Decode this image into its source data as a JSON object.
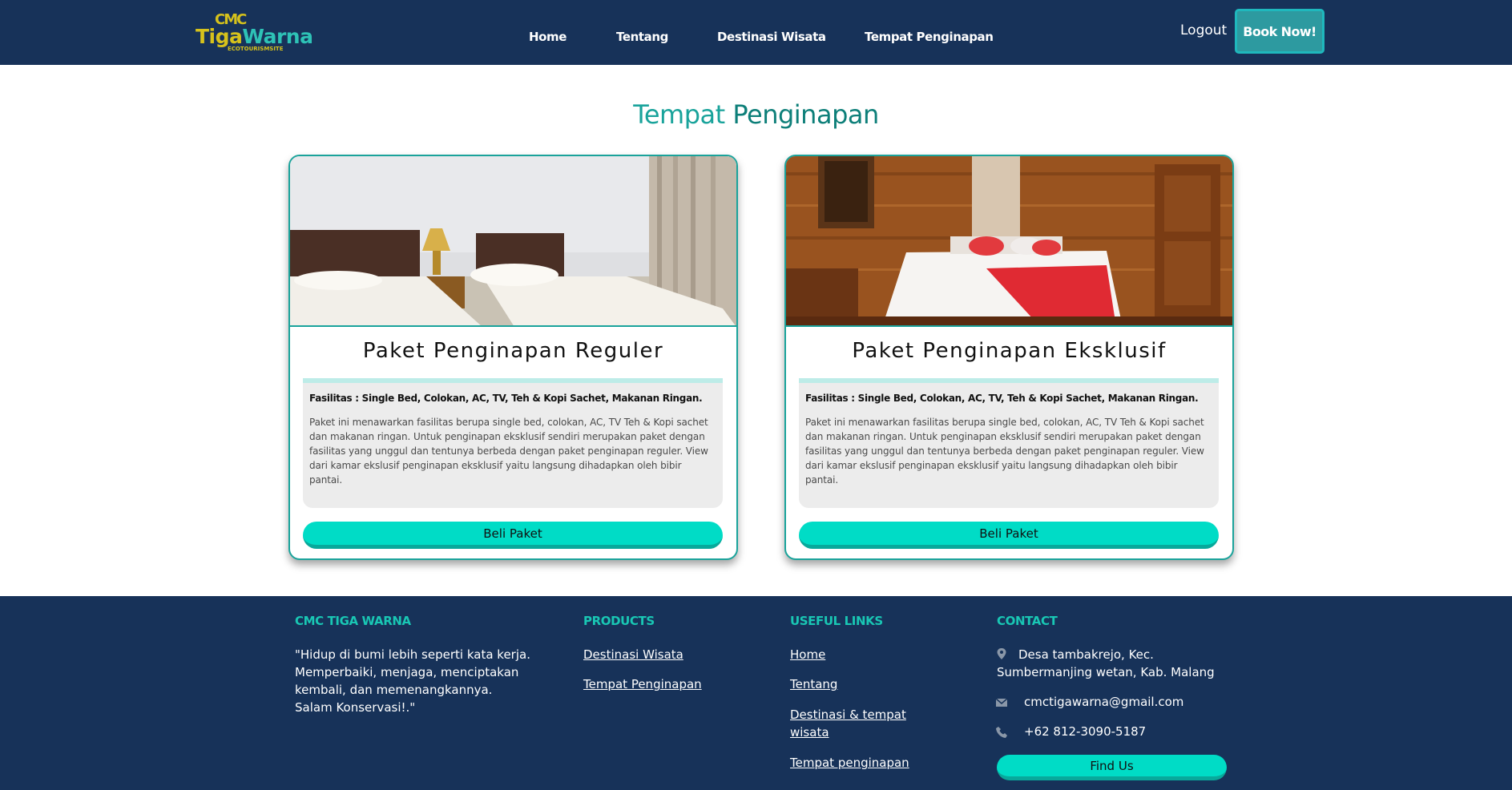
{
  "navbar": {
    "logo": {
      "top": "CMC",
      "main_a": "Tiga",
      "main_b": "Warna",
      "sub": "ECOTOURISMSITE"
    },
    "links": [
      "Home",
      "Tentang",
      "Destinasi Wisata",
      "Tempat Penginapan"
    ],
    "logout": "Logout",
    "book_now": "Book Now!"
  },
  "main": {
    "title_a": "Tempat",
    "title_b": "Penginapan",
    "cards": [
      {
        "title": "Paket Penginapan Reguler",
        "facilities": "Fasilitas : Single Bed, Colokan, AC, TV, Teh & Kopi Sachet, Makanan Ringan.",
        "description": "Paket ini menawarkan fasilitas berupa single bed, colokan, AC, TV Teh & Kopi sachet dan makanan ringan. Untuk penginapan eksklusif sendiri merupakan paket dengan fasilitas yang unggul dan tentunya berbeda dengan paket penginapan reguler. View dari kamar ekslusif penginapan eksklusif yaitu langsung dihadapkan oleh bibir pantai.",
        "button": "Beli Paket"
      },
      {
        "title": "Paket Penginapan Eksklusif",
        "facilities": "Fasilitas : Single Bed, Colokan, AC, TV, Teh & Kopi Sachet, Makanan Ringan.",
        "description": "Paket ini menawarkan fasilitas berupa single bed, colokan, AC, TV Teh & Kopi sachet dan makanan ringan. Untuk penginapan eksklusif sendiri merupakan paket dengan fasilitas yang unggul dan tentunya berbeda dengan paket penginapan reguler. View dari kamar ekslusif penginapan eksklusif yaitu langsung dihadapkan oleh bibir pantai.",
        "button": "Beli Paket"
      }
    ]
  },
  "footer": {
    "brand": {
      "heading": "CMC TIGA WARNA",
      "quote_lines": [
        "\"Hidup di bumi lebih seperti kata kerja.",
        "Memperbaiki, menjaga, menciptakan",
        "kembali, dan memenangkannya.",
        "Salam Konservasi!.\""
      ]
    },
    "products": {
      "heading": "PRODUCTS",
      "links": [
        "Destinasi Wisata",
        "Tempat Penginapan"
      ]
    },
    "useful": {
      "heading": "USEFUL LINKS",
      "links": [
        "Home",
        "Tentang",
        "Destinasi & tempat",
        "wisata",
        "Tempat penginapan"
      ]
    },
    "contact": {
      "heading": "CONTACT",
      "address_line1": "Desa tambakrejo, Kec.",
      "address_line2": "Sumbermanjing wetan, Kab. Malang",
      "email": "cmctigawarna@gmail.com",
      "phone": "+62 812-3090-5187",
      "find_us": "Find Us"
    }
  },
  "colors": {
    "navy": "#173259",
    "teal": "#19a39b",
    "button": "#00dcc6"
  },
  "icons": [
    "map-pin-icon",
    "envelope-icon",
    "phone-icon"
  ]
}
